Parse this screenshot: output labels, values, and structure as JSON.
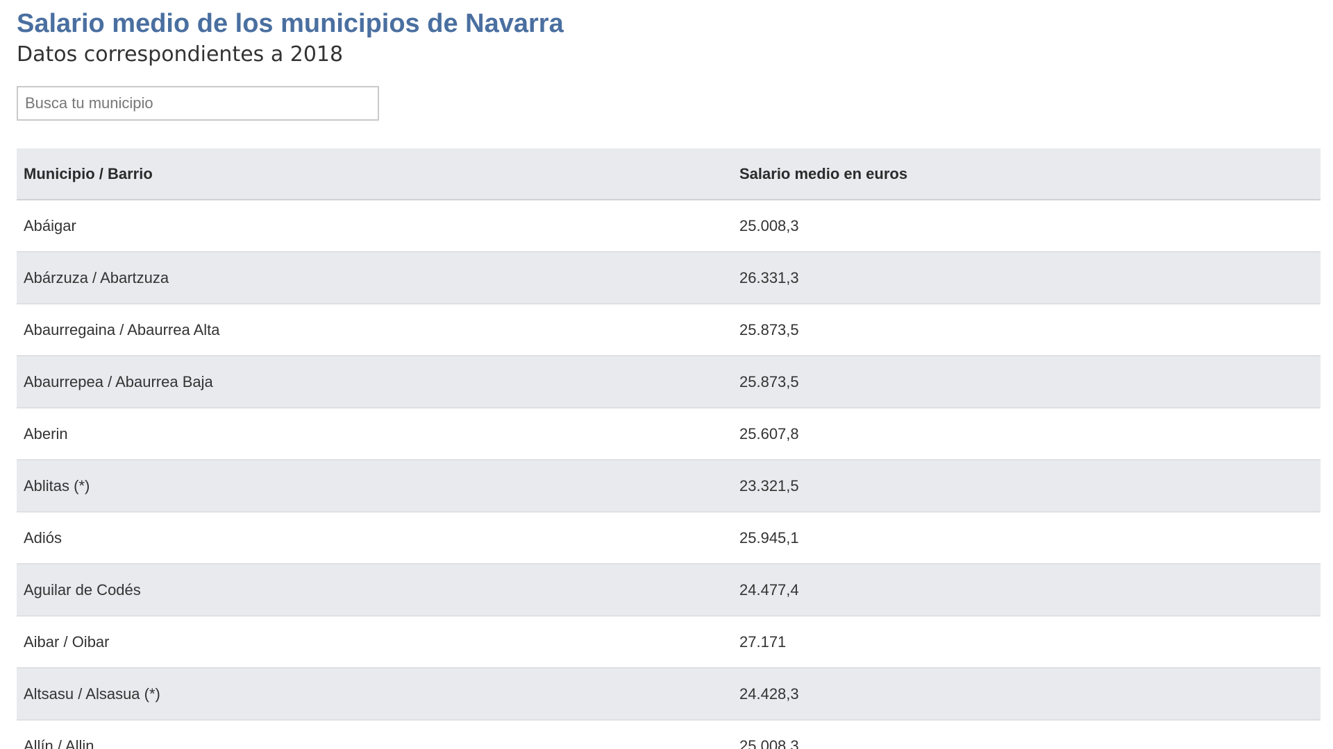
{
  "header": {
    "title": "Salario medio de los municipios de Navarra",
    "subtitle": "Datos correspondientes a 2018"
  },
  "search": {
    "placeholder": "Busca tu municipio",
    "value": ""
  },
  "table": {
    "columns": [
      "Municipio / Barrio",
      "Salario medio en euros"
    ],
    "rows": [
      [
        "Abáigar",
        "25.008,3"
      ],
      [
        "Abárzuza / Abartzuza",
        "26.331,3"
      ],
      [
        "Abaurregaina / Abaurrea Alta",
        "25.873,5"
      ],
      [
        "Abaurrepea / Abaurrea Baja",
        "25.873,5"
      ],
      [
        "Aberin",
        "25.607,8"
      ],
      [
        "Ablitas (*)",
        "23.321,5"
      ],
      [
        "Adiós",
        "25.945,1"
      ],
      [
        "Aguilar de Codés",
        "24.477,4"
      ],
      [
        "Aibar / Oibar",
        "27.171"
      ],
      [
        "Altsasu / Alsasua (*)",
        "24.428,3"
      ],
      [
        "Allín / Allin",
        "25.008,3"
      ]
    ]
  },
  "colors": {
    "title": "#4a6fa0",
    "header_bg": "#e8eaed",
    "stripe_bg": "#e8eaed"
  }
}
